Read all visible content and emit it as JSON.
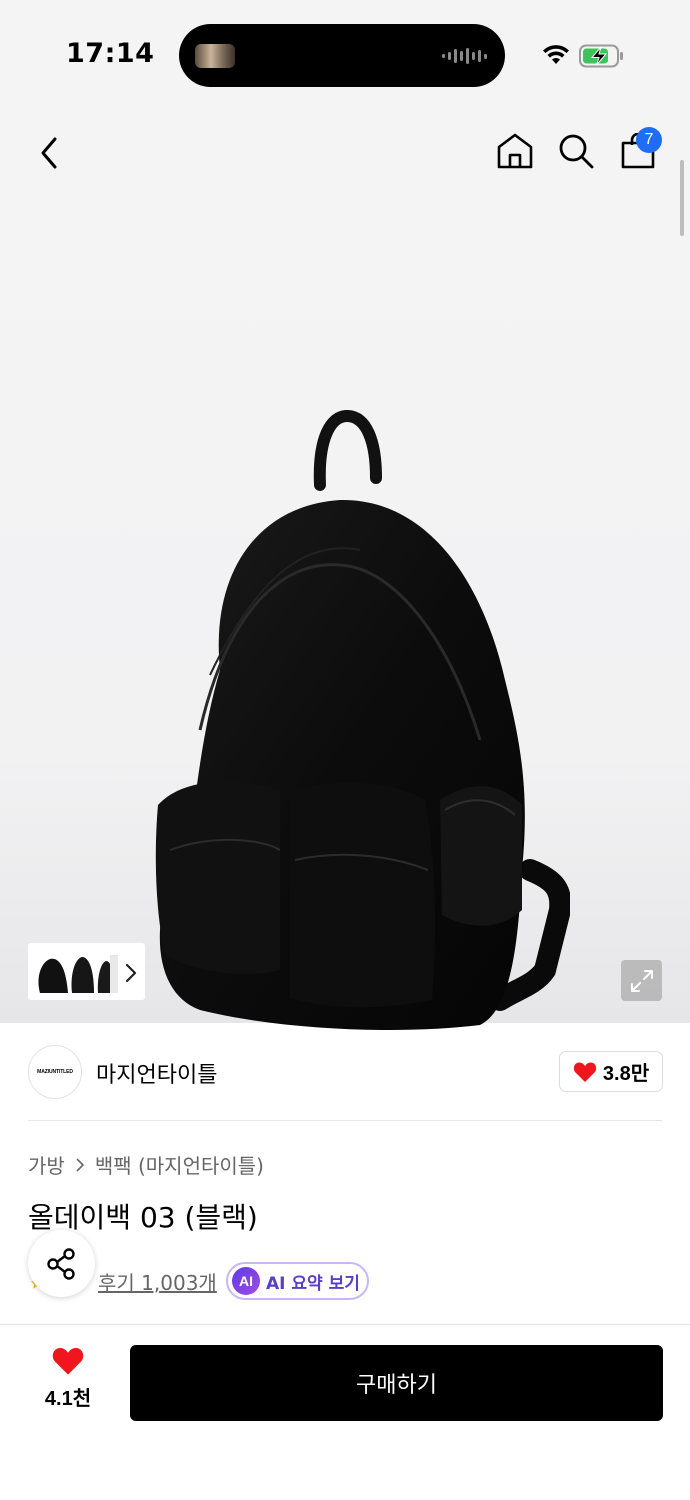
{
  "status_bar": {
    "time": "17:14"
  },
  "header": {
    "back_icon": "chevron-left-icon",
    "home_icon": "home-icon",
    "search_icon": "search-icon",
    "cart_icon": "shopping-bag-icon",
    "cart_badge": "7",
    "badge_color": "#1f6cf5"
  },
  "gallery": {
    "product_image": "black-backpack",
    "thumbnail_more_icon": "chevron-right-icon",
    "expand_icon": "expand-icon"
  },
  "brand": {
    "logo_text": "MAZIUNTITLED",
    "name": "마지언타이틀",
    "like_count": "3.8만",
    "heart_color": "#f0161e"
  },
  "breadcrumb": {
    "category": "가방",
    "subcategory": "백팩 (마지언타이틀)"
  },
  "product": {
    "title": "올데이백 03 (블랙)",
    "review_link": "후기 1,003개",
    "ai_badge": "AI",
    "ai_label": "AI 요약 보기"
  },
  "bottom_bar": {
    "like_count": "4.1천",
    "buy_label": "구매하기"
  }
}
